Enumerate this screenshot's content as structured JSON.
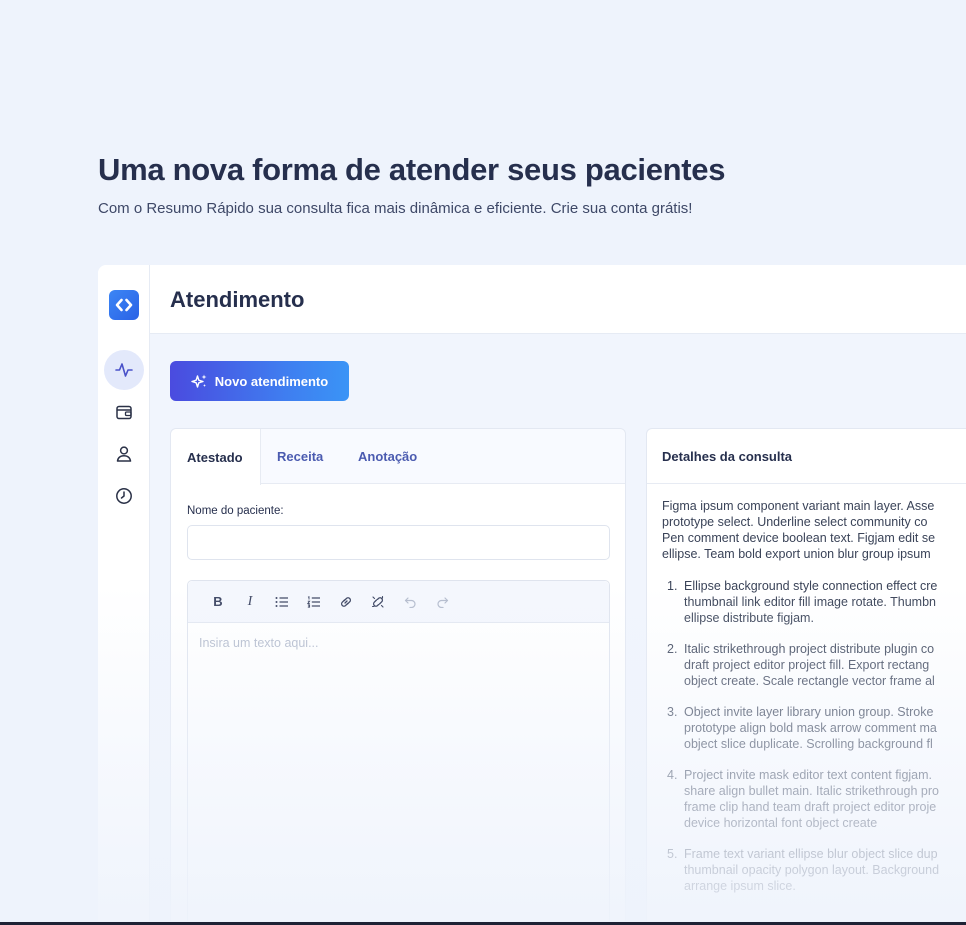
{
  "hero": {
    "title": "Uma nova forma de atender seus pacientes",
    "subtitle": "Com o Resumo Rápido sua consulta fica mais dinâmica e eficiente. Crie sua conta grátis!"
  },
  "sidebar": {
    "logo_icon": "chevrons-code-icon",
    "items": [
      {
        "icon": "activity-icon",
        "active": true
      },
      {
        "icon": "wallet-icon",
        "active": false
      },
      {
        "icon": "user-icon",
        "active": false
      },
      {
        "icon": "clock-icon",
        "active": false
      }
    ]
  },
  "header": {
    "title": "Atendimento"
  },
  "actions": {
    "new_label": "Novo atendimento",
    "new_icon": "sparkles-icon"
  },
  "tabs": [
    "Atestado",
    "Receita",
    "Anotação"
  ],
  "form": {
    "patient_label": "Nome do paciente:",
    "patient_value": "",
    "editor_placeholder": "Insira um texto aqui..."
  },
  "toolbar": {
    "bold": "B",
    "italic": "I",
    "buttons": [
      "bold-icon",
      "italic-icon",
      "bullet-list-icon",
      "ordered-list-icon",
      "link-icon",
      "unlink-icon",
      "undo-icon",
      "redo-icon"
    ]
  },
  "details": {
    "title": "Detalhes da consulta",
    "intro": [
      "Figma ipsum component variant main layer. Asse",
      "prototype select. Underline select community co",
      "Pen comment device boolean text. Figjam edit se",
      "ellipse. Team bold export union blur group ipsum"
    ],
    "items": [
      {
        "num": "1.",
        "lines": [
          "Ellipse background style connection effect cre",
          "thumbnail link editor fill image rotate. Thumbn",
          "ellipse distribute figjam."
        ]
      },
      {
        "num": "2.",
        "lines": [
          "Italic strikethrough project distribute plugin co",
          "draft project editor project fill. Export rectang",
          "object create. Scale rectangle vector frame al"
        ]
      },
      {
        "num": "3.",
        "lines": [
          "Object invite layer library union group. Stroke",
          "prototype align bold mask arrow comment ma",
          "object slice duplicate. Scrolling background fl"
        ]
      },
      {
        "num": "4.",
        "lines": [
          "Project invite mask editor text content figjam.",
          "share align bullet main. Italic strikethrough pro",
          "frame clip hand team draft project editor proje",
          "device horizontal font object create"
        ]
      },
      {
        "num": "5.",
        "lines": [
          "Frame text variant ellipse blur object slice dup",
          "thumbnail opacity polygon layout. Background",
          "arrange ipsum slice."
        ]
      }
    ]
  },
  "colors": {
    "background": "#eef3fc",
    "primary_gradient_start": "#4a4bdf",
    "primary_gradient_end": "#3a94f6",
    "heading": "#262f4d",
    "tab_inactive": "#4b5bb0"
  }
}
